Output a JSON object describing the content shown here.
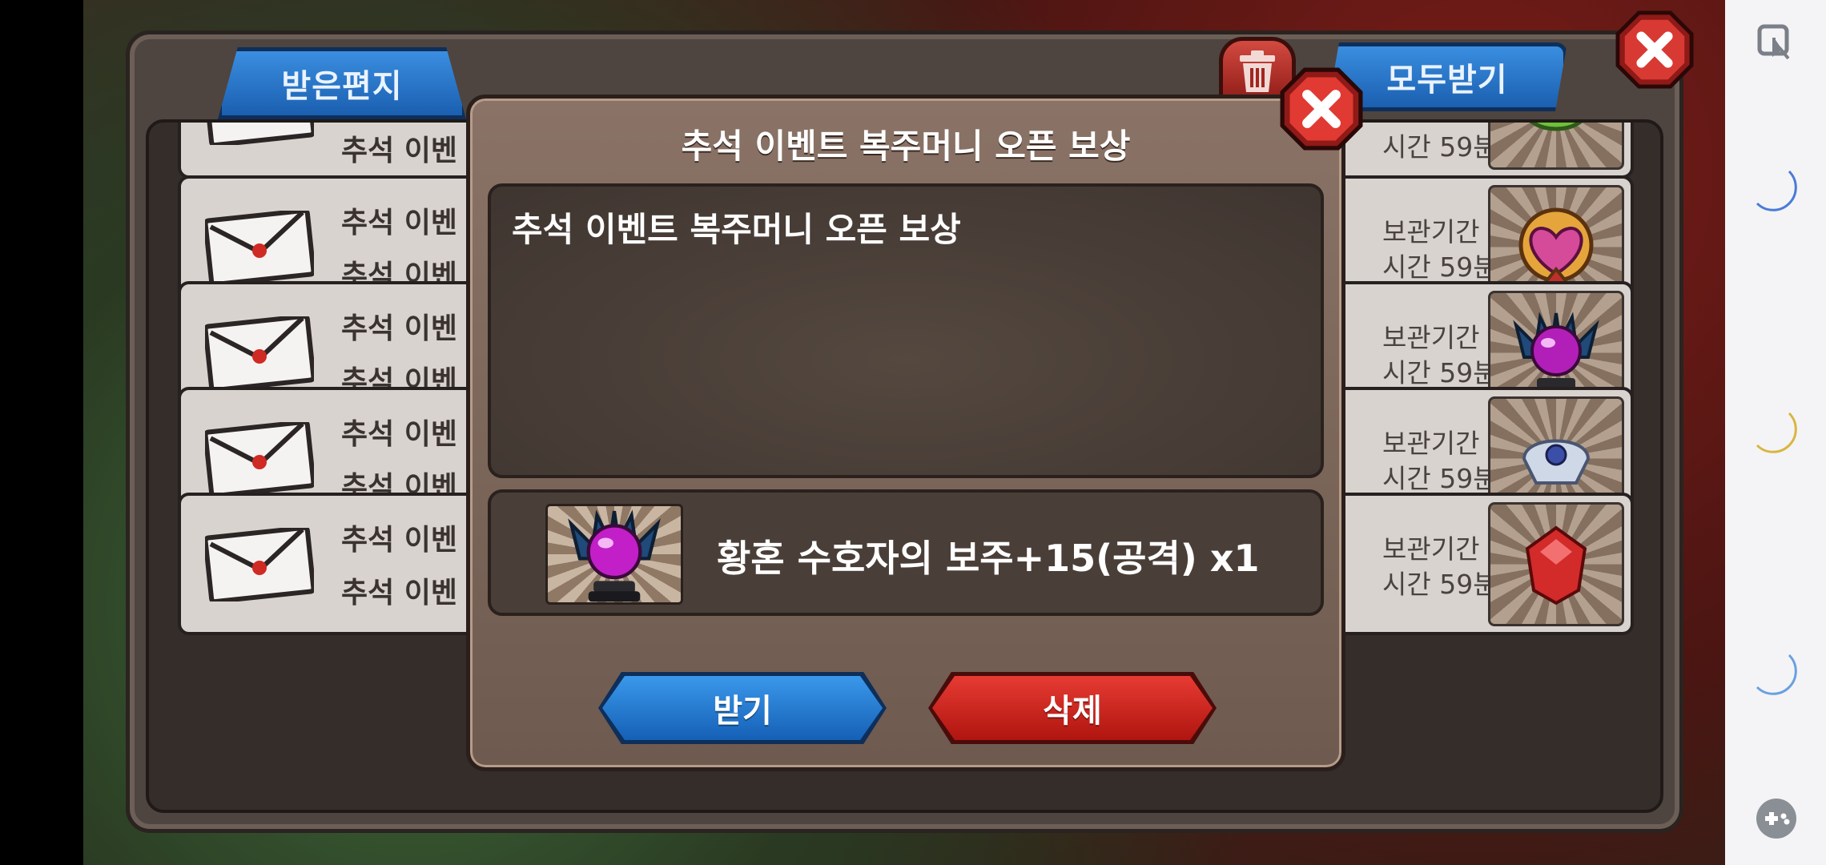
{
  "mailbox": {
    "tab_label": "받은편지",
    "receive_all_label": "모두받기",
    "rows": [
      {
        "line1": "추석 이벤",
        "line2": "",
        "right1": "",
        "right2": "시간 59분"
      },
      {
        "line1": "추석 이벤",
        "line2": "추석 이벤",
        "right1": "보관기간",
        "right2": "시간 59분"
      },
      {
        "line1": "추석 이벤",
        "line2": "추석 이벤",
        "right1": "보관기간",
        "right2": "시간 59분"
      },
      {
        "line1": "추석 이벤",
        "line2": "추석 이벤",
        "right1": "보관기간",
        "right2": "시간 59분"
      },
      {
        "line1": "추석 이벤",
        "line2": "추석 이벤",
        "right1": "보관기간",
        "right2": "시간 59분"
      }
    ]
  },
  "dialog": {
    "title": "추석 이벤트 복주머니 오픈 보상",
    "message": "추석 이벤트 복주머니 오픈 보상",
    "reward_text": "황혼 수호자의 보주+15(공격) x1",
    "receive_label": "받기",
    "delete_label": "삭제"
  },
  "colors": {
    "accent_blue": "#1b5fb0",
    "accent_red": "#b0150f",
    "dialog_bg": "#7a6558"
  },
  "icons": [
    "trash-icon",
    "close-icon",
    "envelope-icon",
    "orb-icon",
    "moon-icon",
    "gamepad-icon",
    "touch-icon"
  ]
}
